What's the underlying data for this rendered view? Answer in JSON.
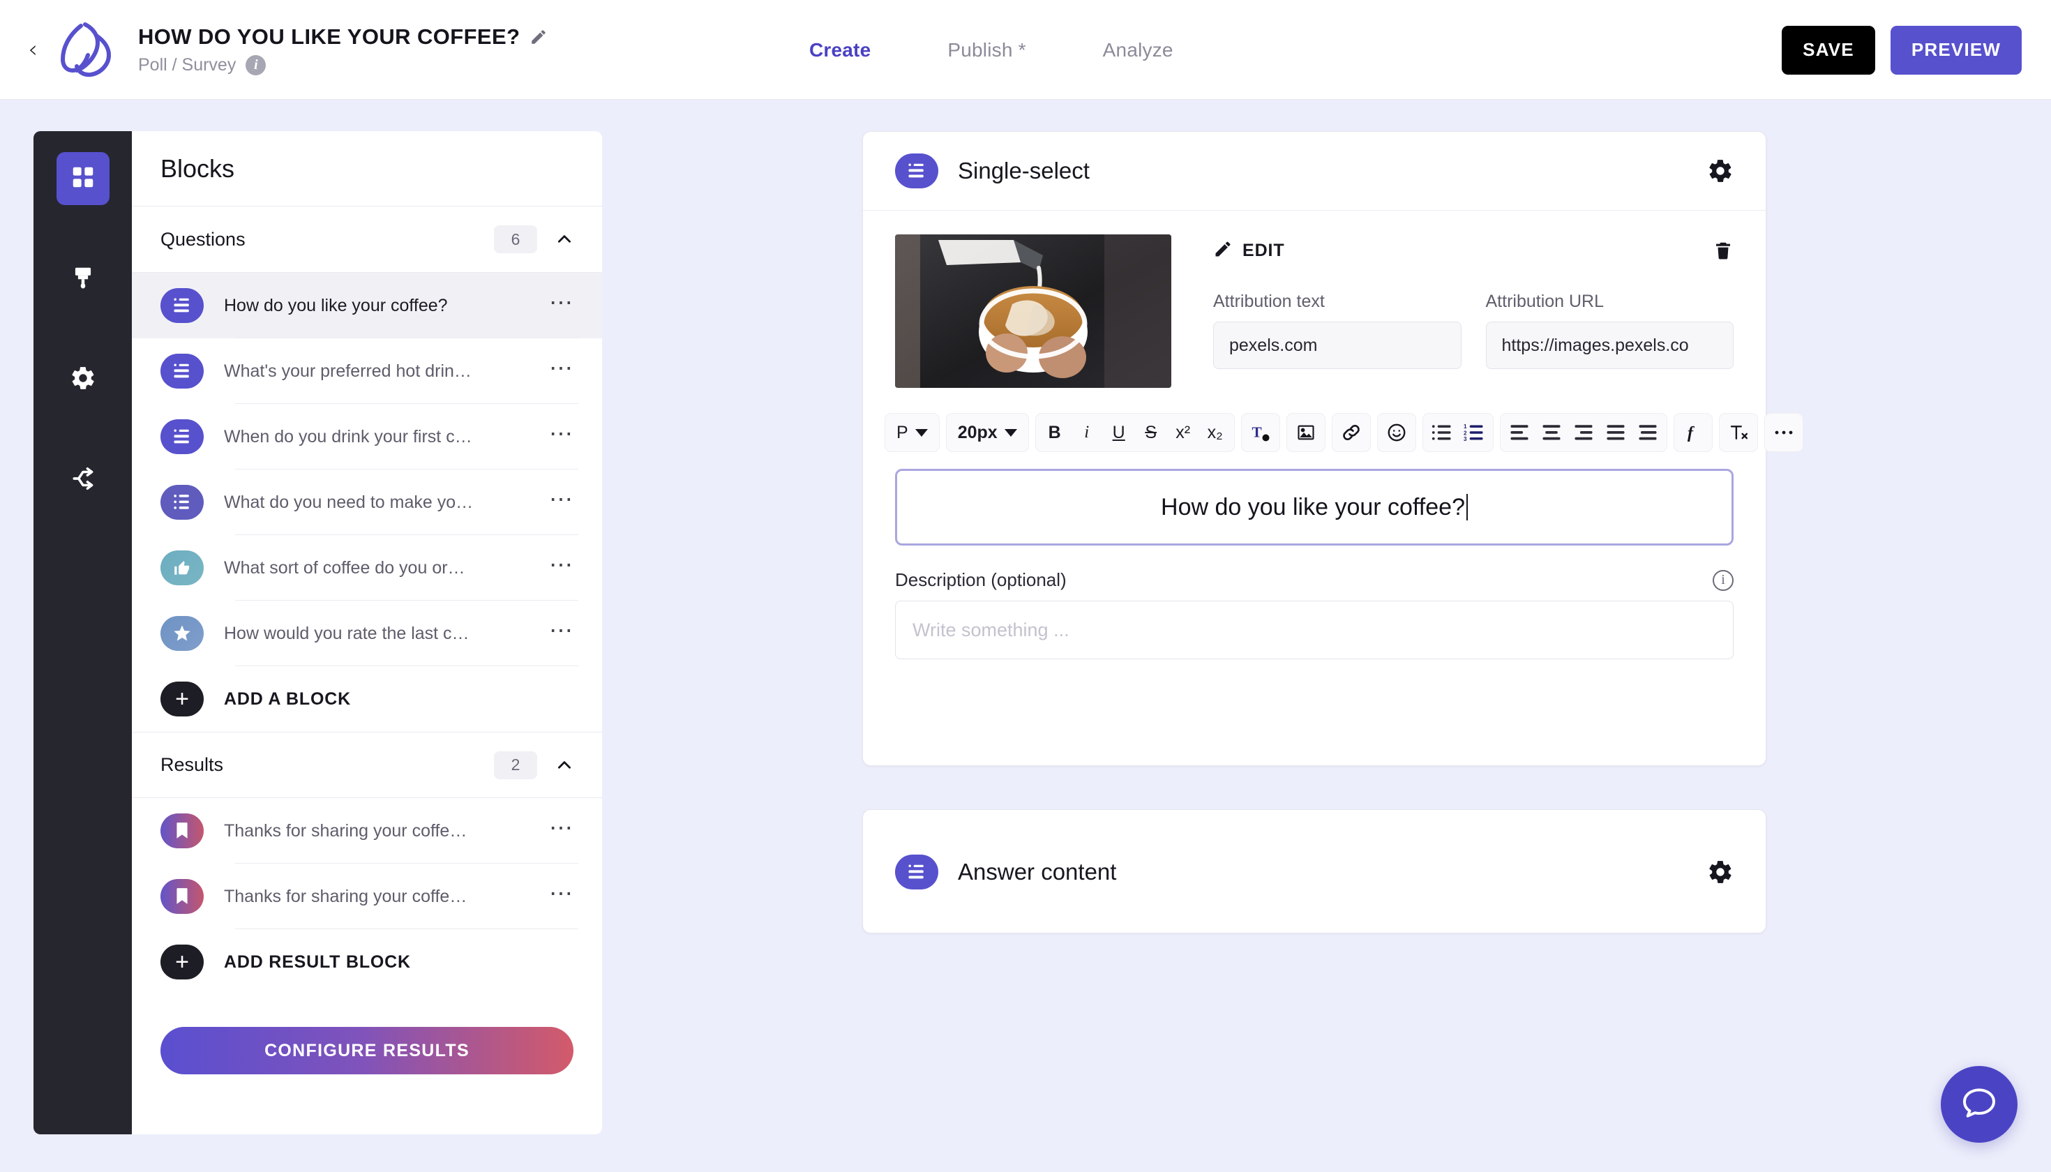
{
  "header": {
    "back_icon": "chevron-left-icon",
    "logo_icon": "brand-logo-icon",
    "title": "HOW DO YOU LIKE YOUR COFFEE?",
    "title_edit_icon": "pencil-icon",
    "subtitle": "Poll / Survey",
    "subtitle_info_icon": "info-icon",
    "info_glyph": "i",
    "tabs": [
      {
        "label": "Create",
        "active": true
      },
      {
        "label": "Publish *",
        "active": false
      },
      {
        "label": "Analyze",
        "active": false
      }
    ],
    "save_label": "SAVE",
    "preview_label": "PREVIEW"
  },
  "rail": {
    "items": [
      {
        "icon": "blocks-grid-icon",
        "active": true
      },
      {
        "icon": "paintbrush-icon",
        "active": false
      },
      {
        "icon": "gear-icon",
        "active": false
      },
      {
        "icon": "share-branch-icon",
        "active": false
      }
    ]
  },
  "panel": {
    "title": "Blocks",
    "questions_section": {
      "label": "Questions",
      "count": "6",
      "collapse_icon": "chevron-up-icon",
      "items": [
        {
          "label": "How do you like your coffee?",
          "icon": "single-select-icon",
          "selected": true
        },
        {
          "label": "What's your preferred hot drin…",
          "icon": "single-select-icon",
          "selected": false
        },
        {
          "label": "When do you drink your first c…",
          "icon": "single-select-icon",
          "selected": false
        },
        {
          "label": "What do you need to make yo…",
          "icon": "multi-select-icon",
          "selected": false
        },
        {
          "label": "What sort of coffee do you or…",
          "icon": "thumbs-up-icon",
          "selected": false
        },
        {
          "label": "How would you rate the last c…",
          "icon": "star-icon",
          "selected": false
        }
      ],
      "add_label": "ADD A BLOCK",
      "add_icon": "plus-icon"
    },
    "results_section": {
      "label": "Results",
      "count": "2",
      "collapse_icon": "chevron-up-icon",
      "items": [
        {
          "label": "Thanks for sharing your coffe…",
          "icon": "bookmark-icon"
        },
        {
          "label": "Thanks for sharing your coffe…",
          "icon": "bookmark-icon"
        }
      ],
      "add_label": "ADD RESULT BLOCK",
      "add_icon": "plus-icon"
    },
    "configure_label": "CONFIGURE RESULTS",
    "row_menu_icon": "ellipsis-icon"
  },
  "question_card": {
    "type_icon": "single-select-icon",
    "type_label": "Single-select",
    "settings_icon": "gear-icon",
    "media": {
      "image_alt": "barista pouring latte art into white cup",
      "edit_icon": "pencil-icon",
      "edit_label": "EDIT",
      "delete_icon": "trash-icon",
      "attribution_text_label": "Attribution text",
      "attribution_text_value": "pexels.com",
      "attribution_url_label": "Attribution URL",
      "attribution_url_value": "https://images.pexels.co"
    },
    "toolbar": {
      "paragraph_style": "P",
      "font_size": "20px",
      "bold": "B",
      "italic": "i",
      "underline": "U",
      "strike": "S",
      "superscript": "x²",
      "subscript": "x₂",
      "text_color_icon": "text-color-icon",
      "image_icon": "insert-image-icon",
      "link_icon": "link-icon",
      "emoji_icon": "emoji-icon",
      "bullet_list_icon": "bullet-list-icon",
      "numbered_list_icon": "numbered-list-icon",
      "align_left_icon": "align-left-icon",
      "align_center_icon": "align-center-icon",
      "align_right_icon": "align-right-icon",
      "align_justify_icon": "align-justify-icon",
      "indent_icon": "indent-icon",
      "outdent_icon": "outdent-icon",
      "formula_icon": "formula-icon",
      "clear_format_icon": "clear-formatting-icon",
      "more_icon": "ellipsis-icon"
    },
    "question_value": "How do you like your coffee?",
    "description_label": "Description (optional)",
    "description_info_icon": "info-icon",
    "description_placeholder": "Write something ...",
    "description_value": ""
  },
  "answer_card": {
    "type_icon": "single-select-icon",
    "type_label": "Answer content",
    "settings_icon": "gear-icon"
  },
  "chat_fab": {
    "icon": "chat-bubble-icon"
  },
  "colors": {
    "brand_purple": "#5751ce",
    "accent_purple": "#4a41c4",
    "rail_dark": "#26262e",
    "page_bg": "#eceefb",
    "focus_border": "#a9a6e0",
    "gradient_start": "#5a4fd0",
    "gradient_end": "#d35a6a"
  }
}
